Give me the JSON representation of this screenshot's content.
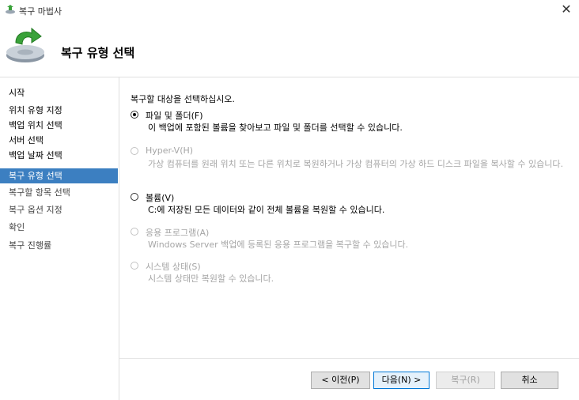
{
  "window": {
    "title": "복구 마법사",
    "close_symbol": "✕"
  },
  "header": {
    "heading": "복구 유형 선택",
    "icon": "restore-wizard-icon"
  },
  "sidebar": {
    "items": [
      {
        "label": "시작",
        "selected": false
      },
      {
        "label": "위치 유형 지정",
        "selected": false
      },
      {
        "label": "백업 위치 선택",
        "selected": false
      },
      {
        "label": "서버 선택",
        "selected": false
      },
      {
        "label": "백업 날짜 선택",
        "selected": false
      },
      {
        "label": "복구 유형 선택",
        "selected": true
      },
      {
        "label": "복구할 항목 선택",
        "selected": false
      },
      {
        "label": "복구 옵션 지정",
        "selected": false
      },
      {
        "label": "확인",
        "selected": false
      },
      {
        "label": "복구 진행률",
        "selected": false
      }
    ]
  },
  "main": {
    "prompt": "복구할 대상을 선택하십시오.",
    "options": [
      {
        "label": "파일 및 폴더(F)",
        "description": "이 백업에 포함된 볼륨을 찾아보고 파일 및 폴더를 선택할 수 있습니다.",
        "checked": true,
        "enabled": true
      },
      {
        "label": "Hyper-V(H)",
        "description": "가상 컴퓨터를 원래 위치 또는 다른 위치로 복원하거나 가상 컴퓨터의 가상 하드 디스크 파일을 복사할 수 있습니다.",
        "checked": false,
        "enabled": false
      },
      {
        "label": "볼륨(V)",
        "description": "C:에 저장된 모든 데이터와 같이 전체 볼륨을 복원할 수 있습니다.",
        "checked": false,
        "enabled": true
      },
      {
        "label": "응용 프로그램(A)",
        "description": "Windows Server 백업에 등록된 응용 프로그램을 복구할 수 있습니다.",
        "checked": false,
        "enabled": false
      },
      {
        "label": "시스템 상태(S)",
        "description": "시스템 상태만 복원할 수 있습니다.",
        "checked": false,
        "enabled": false
      }
    ]
  },
  "buttons": {
    "back": "< 이전(P)",
    "next": "다음(N) >",
    "recover": "복구(R)",
    "cancel": "취소"
  },
  "colors": {
    "selection": "#3c7fc1",
    "disabled_text": "#a6a6a6"
  }
}
